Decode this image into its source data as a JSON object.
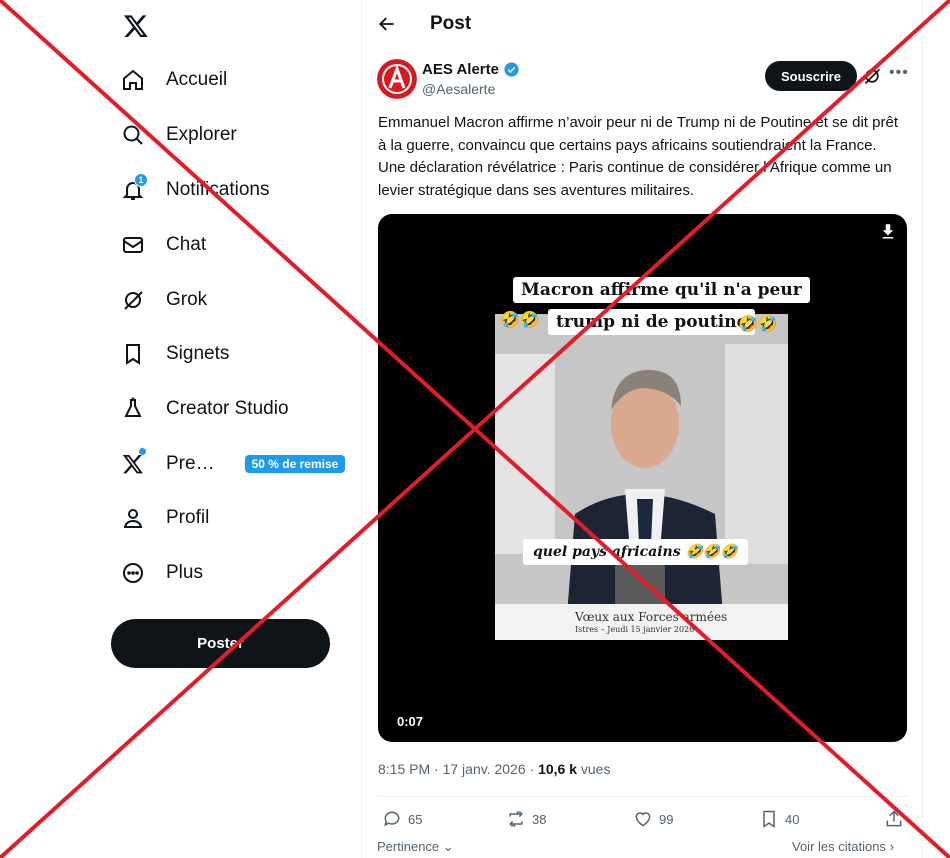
{
  "sidebar": {
    "logo": "x-logo-icon",
    "items": [
      {
        "label": "Accueil",
        "icon": "home-icon"
      },
      {
        "label": "Explorer",
        "icon": "search-icon"
      },
      {
        "label": "Notifications",
        "icon": "bell-icon",
        "badge": "1"
      },
      {
        "label": "Chat",
        "icon": "mail-icon"
      },
      {
        "label": "Grok",
        "icon": "grok-icon"
      },
      {
        "label": "Signets",
        "icon": "bookmark-icon"
      },
      {
        "label": "Creator Studio",
        "icon": "flask-icon"
      },
      {
        "label": "Pre…",
        "icon": "x-premium-icon",
        "promo": "50 % de remise"
      },
      {
        "label": "Profil",
        "icon": "person-icon"
      },
      {
        "label": "Plus",
        "icon": "more-circle-icon"
      }
    ],
    "post_button": "Poster"
  },
  "header": {
    "title": "Post"
  },
  "tweet": {
    "author": "AES Alerte",
    "handle": "@Aesalerte",
    "subscribe_label": "Souscrire",
    "text": "Emmanuel Macron affirme n’avoir peur ni de Trump ni de Poutine et se dit prêt à la guerre, convaincu que certains pays africains soutiendraient la France. Une déclaration révélatrice : Paris continue de considérer l’Afrique comme un levier stratégique dans ses aventures militaires.",
    "video": {
      "caption_line1": "Macron affirme qu'il n'a peur",
      "caption_line2": "trump ni de poutine",
      "caption_bottom": "quel pays africains",
      "banner_title": "Vœux aux Forces armées",
      "banner_sub": "Istres – Jeudi 15 janvier 2026",
      "duration": "0:07",
      "emoji": "🤣🤣"
    },
    "time": "8:15 PM · 17 janv. 2026 · ",
    "views_count": "10,6 k",
    "views_label": " vues",
    "stats": {
      "replies": "65",
      "reposts": "38",
      "likes": "99",
      "bookmarks": "40"
    }
  },
  "footer": {
    "sort_label": "Pertinence",
    "quotes_label": "Voir les citations"
  },
  "colors": {
    "accent": "#1d9bf0",
    "cross": "#e11d2a",
    "dark": "#0f1419"
  }
}
